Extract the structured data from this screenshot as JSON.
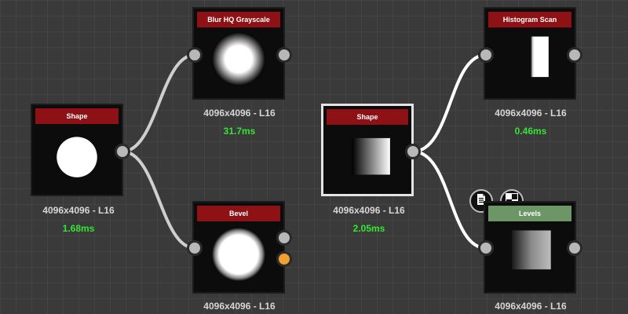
{
  "graph": {
    "nodes": {
      "shape_1": {
        "title": "Shape",
        "resolution": "4096x4096 - L16",
        "timing": "1.68ms"
      },
      "blur": {
        "title": "Blur HQ Grayscale",
        "resolution": "4096x4096 - L16",
        "timing": "31.7ms"
      },
      "bevel": {
        "title": "Bevel",
        "resolution": "4096x4096 - L16"
      },
      "shape_2": {
        "title": "Shape",
        "resolution": "4096x4096 - L16",
        "timing": "2.05ms"
      },
      "histogram": {
        "title": "Histogram Scan",
        "resolution": "4096x4096 - L16",
        "timing": "0.46ms"
      },
      "levels": {
        "title": "Levels",
        "resolution": "4096x4096 - L16"
      }
    },
    "node_toolbar_icons": [
      "document-icon",
      "checker-icon"
    ]
  },
  "colors": {
    "title_bar": "#8e1116",
    "levels_title_bar": "#6d9667",
    "timing_text": "#33e633",
    "wire": "#cfcfcf",
    "selected_border": "#e4e4e4",
    "accent_port": "#f0a030"
  }
}
